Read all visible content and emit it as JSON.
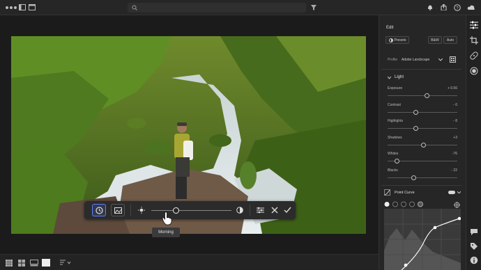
{
  "panel": {
    "title": "Edit",
    "presets_label": "Presets",
    "bw_label": "B&W",
    "auto_label": "Auto",
    "profile_label": "Profile",
    "profile_value": "Adobe Landscape",
    "light_section": "Light",
    "sliders": [
      {
        "label": "Exposure",
        "value": "+ 0.56",
        "level": 0.56
      },
      {
        "label": "Contrast",
        "value": "- 6",
        "level": 0.4
      },
      {
        "label": "Highlights",
        "value": "- 8",
        "level": 0.4
      },
      {
        "label": "Shadows",
        "value": "+3",
        "level": 0.51
      },
      {
        "label": "Whites",
        "value": "-76",
        "level": 0.13
      },
      {
        "label": "Blacks",
        "value": "- 22",
        "level": 0.37
      }
    ],
    "point_curve_label": "Point Curve"
  },
  "toolbar": {
    "tooltip": "Morning",
    "slider_level": 0.31
  },
  "colors": {
    "background": "#1c1c1c",
    "panel": "#262626",
    "toolbar_active": "#5b7fff"
  }
}
